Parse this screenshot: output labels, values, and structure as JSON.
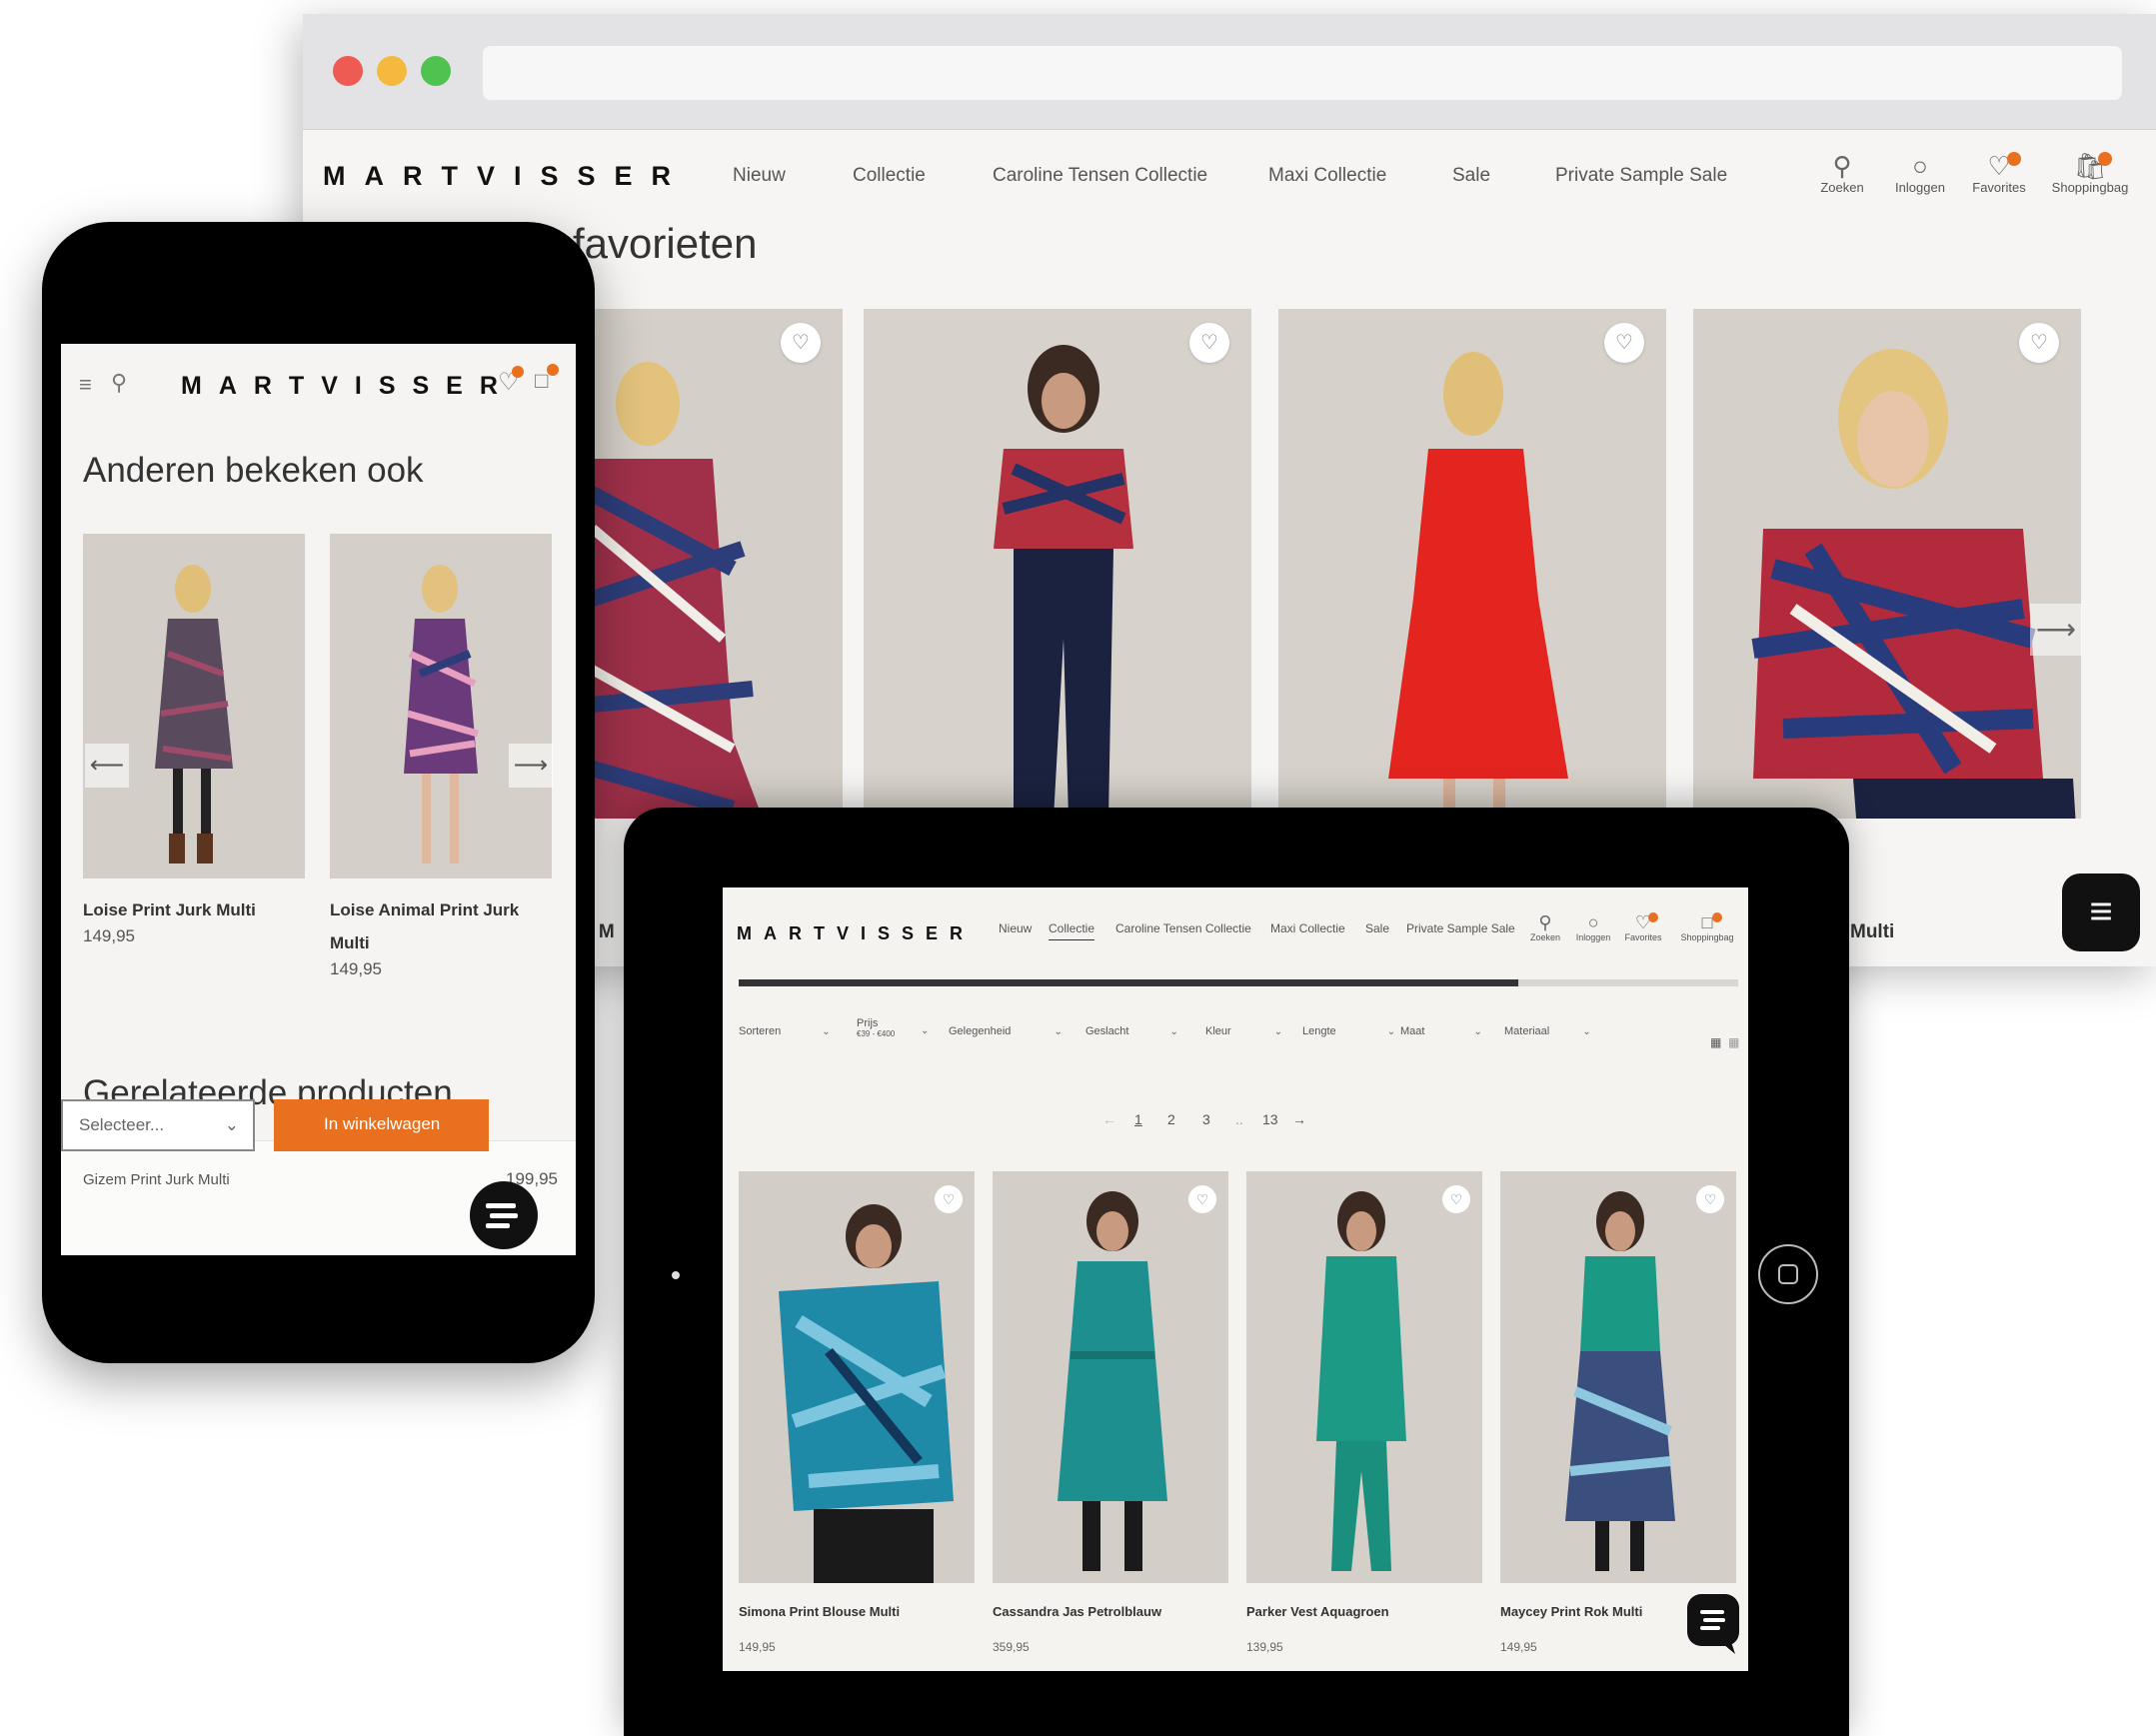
{
  "browser": {
    "traffic_lights": [
      "#ee5b52",
      "#f5b93f",
      "#4fc24f"
    ],
    "logo": "MARTVISSER",
    "nav": [
      "Nieuw",
      "Collectie",
      "Caroline Tensen Collectie",
      "Maxi Collectie",
      "Sale",
      "Private Sample Sale"
    ],
    "icons": [
      {
        "label": "Zoeken",
        "icon": "search-icon"
      },
      {
        "label": "Inloggen",
        "icon": "user-icon"
      },
      {
        "label": "Favorites",
        "icon": "heart-icon"
      },
      {
        "label": "Shoppingbag",
        "icon": "bag-icon"
      }
    ],
    "section_title": "favorieten",
    "product_names": [
      "k M",
      "Multi"
    ],
    "accent": "#e8701e"
  },
  "phone": {
    "logo": "MARTVISSER",
    "section1_title": "Anderen bekeken ook",
    "products": [
      {
        "name": "Loise Print Jurk Multi",
        "price": "149,95"
      },
      {
        "name": "Loise Animal Print Jurk Multi",
        "price": "149,95"
      }
    ],
    "section2_title": "Gerelateerde producten",
    "related": {
      "name": "Gizem Print Jurk Multi",
      "price": "199,95"
    },
    "select_placeholder": "Selecteer...",
    "add_to_cart": "In winkelwagen"
  },
  "tablet": {
    "logo": "MARTVISSER",
    "nav": [
      "Nieuw",
      "Collectie",
      "Caroline Tensen Collectie",
      "Maxi Collectie",
      "Sale",
      "Private Sample Sale"
    ],
    "icons": [
      {
        "label": "Zoeken",
        "icon": "search-icon"
      },
      {
        "label": "Inloggen",
        "icon": "user-icon"
      },
      {
        "label": "Favorites",
        "icon": "heart-icon"
      },
      {
        "label": "Shoppingbag",
        "icon": "bag-icon"
      }
    ],
    "progress": 0.78,
    "filters": [
      "Sorteren",
      "Prijs",
      "Gelegenheid",
      "Geslacht",
      "Kleur",
      "Lengte",
      "Maat",
      "Materiaal"
    ],
    "price_range": "€39 - €400",
    "pagination": [
      "←",
      "1",
      "2",
      "3",
      "..",
      "13",
      "→"
    ],
    "products": [
      {
        "name": "Simona Print Blouse Multi",
        "price": "149,95"
      },
      {
        "name": "Cassandra Jas Petrolblauw",
        "price": "359,95"
      },
      {
        "name": "Parker Vest Aquagroen",
        "price": "139,95"
      },
      {
        "name": "Maycey Print Rok Multi",
        "price": "149,95"
      }
    ]
  }
}
